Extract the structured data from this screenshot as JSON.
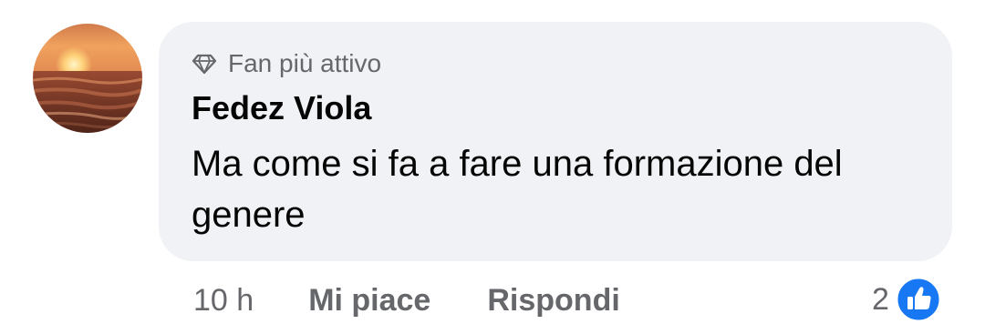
{
  "comment": {
    "badge_label": "Fan più attivo",
    "badge_icon": "diamond-icon",
    "author": "Fedez Viola",
    "text": "Ma come si fa a fare una formazione del genere",
    "avatar": "sunset-sea-avatar"
  },
  "actions": {
    "time": "10 h",
    "like_label": "Mi piace",
    "reply_label": "Rispondi"
  },
  "reactions": {
    "count": "2",
    "icon": "thumbs-up-icon",
    "color": "#1877f2"
  },
  "colors": {
    "bubble": "#f0f2f5",
    "secondary_text": "#65676b",
    "primary_text": "#050505"
  }
}
